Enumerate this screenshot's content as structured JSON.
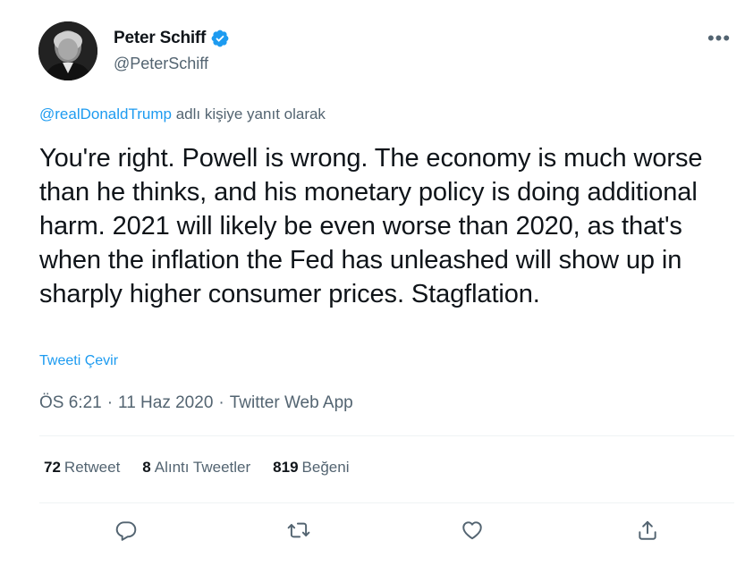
{
  "author": {
    "display_name": "Peter Schiff",
    "handle": "@PeterSchiff"
  },
  "more_icon": "more-horizontal-icon",
  "reply_context": {
    "mention": "@realDonaldTrump",
    "suffix": " adlı kişiye yanıt olarak"
  },
  "tweet": {
    "text": "You're right. Powell is wrong. The economy is much worse than he thinks, and his monetary policy is doing additional harm. 2021 will likely be even worse than 2020, as that's when the inflation the Fed has unleashed will show up in sharply higher consumer prices. Stagflation.",
    "translate_label": "Tweeti Çevir",
    "time": "ÖS 6:21",
    "separator": "·",
    "date": "11 Haz 2020",
    "source": "Twitter Web App"
  },
  "stats": {
    "retweets": {
      "count": "72",
      "label": "Retweet"
    },
    "quotes": {
      "count": "8",
      "label": "Alıntı Tweetler"
    },
    "likes": {
      "count": "819",
      "label": "Beğeni"
    }
  },
  "actions": [
    "reply-icon",
    "retweet-icon",
    "like-icon",
    "share-icon"
  ],
  "colors": {
    "accent": "#1d9bf0",
    "text_primary": "#0f1419",
    "text_secondary": "#536471",
    "divider": "#eff3f4"
  }
}
